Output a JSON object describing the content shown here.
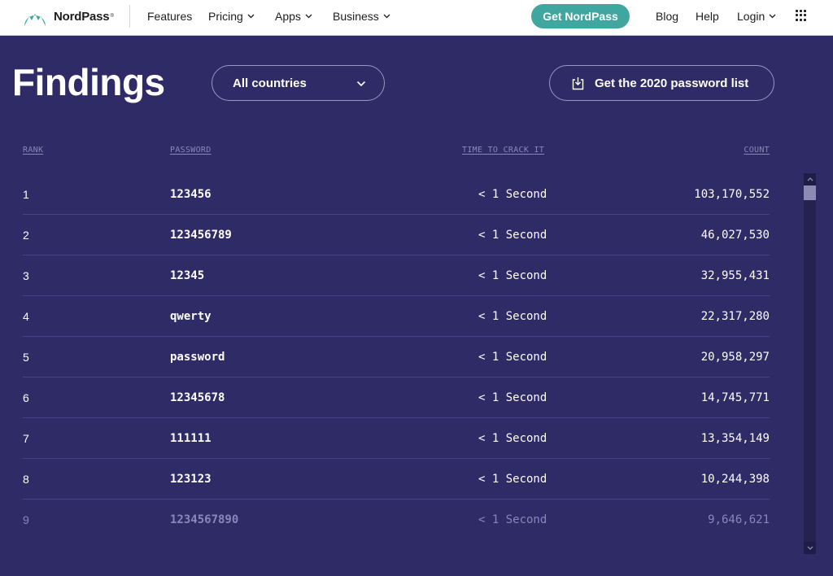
{
  "nav": {
    "brand": "NordPass",
    "brand_mark": "®",
    "items": [
      {
        "label": "Features",
        "has_dropdown": false
      },
      {
        "label": "Pricing",
        "has_dropdown": true
      },
      {
        "label": "Apps",
        "has_dropdown": true
      },
      {
        "label": "Business",
        "has_dropdown": true
      }
    ],
    "cta_label": "Get NordPass",
    "right_items": [
      {
        "label": "Blog",
        "has_dropdown": false
      },
      {
        "label": "Help",
        "has_dropdown": false
      },
      {
        "label": "Login",
        "has_dropdown": true
      }
    ],
    "apps_grid_icon": "grid-icon",
    "colors": {
      "cta": "#3fa79f",
      "logo": "#3fa79f"
    }
  },
  "header": {
    "title": "Findings",
    "country_select": {
      "value": "All countries",
      "icon": "chevron-down-icon"
    },
    "download_button": {
      "label": "Get the 2020 password list",
      "icon": "download-icon"
    }
  },
  "table": {
    "columns": [
      "RANK",
      "PASSWORD",
      "TIME TO CRACK IT",
      "COUNT"
    ],
    "rows": [
      {
        "rank": "1",
        "password": "123456",
        "time": "< 1 Second",
        "count": "103,170,552"
      },
      {
        "rank": "2",
        "password": "123456789",
        "time": "< 1 Second",
        "count": "46,027,530"
      },
      {
        "rank": "3",
        "password": "12345",
        "time": "< 1 Second",
        "count": "32,955,431"
      },
      {
        "rank": "4",
        "password": "qwerty",
        "time": "< 1 Second",
        "count": "22,317,280"
      },
      {
        "rank": "5",
        "password": "password",
        "time": "< 1 Second",
        "count": "20,958,297"
      },
      {
        "rank": "6",
        "password": "12345678",
        "time": "< 1 Second",
        "count": "14,745,771"
      },
      {
        "rank": "7",
        "password": "111111",
        "time": "< 1 Second",
        "count": "13,354,149"
      },
      {
        "rank": "8",
        "password": "123123",
        "time": "< 1 Second",
        "count": "10,244,398"
      },
      {
        "rank": "9",
        "password": "1234567890",
        "time": "< 1 Second",
        "count": "9,646,621"
      }
    ]
  },
  "theme": {
    "background": "#2e2b66",
    "row_divider": "#46438a",
    "muted_text": "#8a87b8"
  }
}
